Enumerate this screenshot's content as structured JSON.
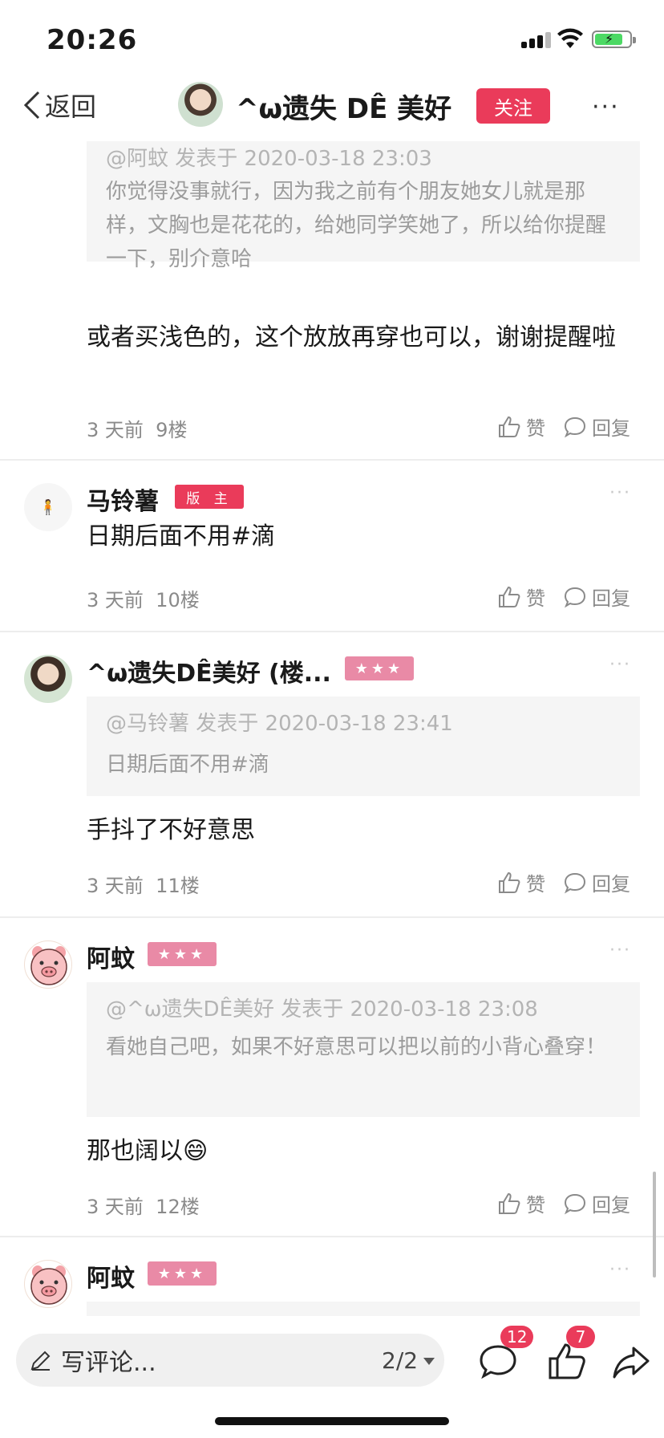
{
  "status_bar": {
    "time": "20:26"
  },
  "navbar": {
    "back_label": "返回",
    "title": "^ω遗失 DÊ 美好",
    "follow_label": "关注",
    "more_label": "···"
  },
  "comments": [
    {
      "quote": {
        "meta": "@阿蚊 发表于 2020-03-18 23:03",
        "text": "你觉得没事就行，因为我之前有个朋友她女儿就是那样，文胸也是花花的，给她同学笑她了，所以给你提醒一下，别介意哈"
      },
      "text": "或者买浅色的，这个放放再穿也可以，谢谢提醒啦",
      "time": "3 天前",
      "floor": "9楼",
      "like_label": "赞",
      "reply_label": "回复"
    },
    {
      "username": "马铃薯",
      "badge": "版 主",
      "text": "日期后面不用#滴",
      "time": "3 天前",
      "floor": "10楼",
      "like_label": "赞",
      "reply_label": "回复"
    },
    {
      "username": "^ω遗失DÊ美好 (楼...",
      "badge": "★★★",
      "quote": {
        "meta": "@马铃薯 发表于 2020-03-18 23:41",
        "text": "日期后面不用#滴"
      },
      "text": "手抖了不好意思",
      "time": "3 天前",
      "floor": "11楼",
      "like_label": "赞",
      "reply_label": "回复"
    },
    {
      "username": "阿蚊",
      "badge": "★★★",
      "quote": {
        "meta": "@^ω遗失DÊ美好 发表于 2020-03-18 23:08",
        "text": "看她自己吧，如果不好意思可以把以前的小背心叠穿！"
      },
      "text": "那也阔以",
      "emoji": "😄",
      "time": "3 天前",
      "floor": "12楼",
      "like_label": "赞",
      "reply_label": "回复"
    },
    {
      "username": "阿蚊",
      "badge": "★★★"
    }
  ],
  "bottom_bar": {
    "placeholder": "写评论...",
    "page_indicator": "2/2",
    "comment_count": "12",
    "like_count": "7"
  },
  "colors": {
    "accent": "#ea3b5a",
    "star_badge": "#e98aa6"
  }
}
